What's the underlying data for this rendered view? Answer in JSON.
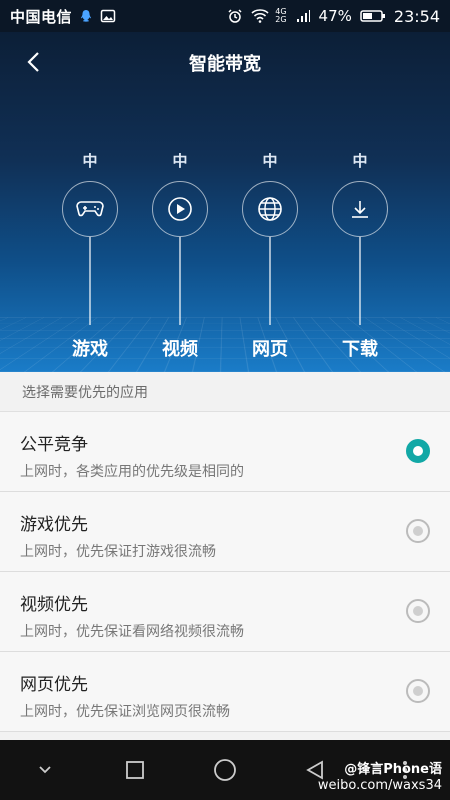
{
  "statusbar": {
    "carrier": "中国电信",
    "battery_percent": "47%",
    "time": "23:54",
    "network_top": "4G",
    "network_bottom": "2G"
  },
  "header": {
    "title": "智能带宽"
  },
  "categories": [
    {
      "level": "中",
      "label": "游戏",
      "icon": "gamepad-icon"
    },
    {
      "level": "中",
      "label": "视频",
      "icon": "play-circle-icon"
    },
    {
      "level": "中",
      "label": "网页",
      "icon": "globe-icon"
    },
    {
      "level": "中",
      "label": "下载",
      "icon": "download-icon"
    }
  ],
  "section": {
    "title": "选择需要优先的应用"
  },
  "options": [
    {
      "title": "公平竞争",
      "desc": "上网时，各类应用的优先级是相同的",
      "selected": true
    },
    {
      "title": "游戏优先",
      "desc": "上网时，优先保证打游戏很流畅",
      "selected": false
    },
    {
      "title": "视频优先",
      "desc": "上网时，优先保证看网络视频很流畅",
      "selected": false
    },
    {
      "title": "网页优先",
      "desc": "上网时，优先保证浏览网页很流畅",
      "selected": false
    }
  ],
  "watermark": {
    "line1": "@锋言Phone语",
    "line2": "weibo.com/waxs34"
  },
  "colors": {
    "accent": "#12a8a6",
    "hero_top": "#0c1f37",
    "hero_bottom": "#1a7cc8"
  }
}
